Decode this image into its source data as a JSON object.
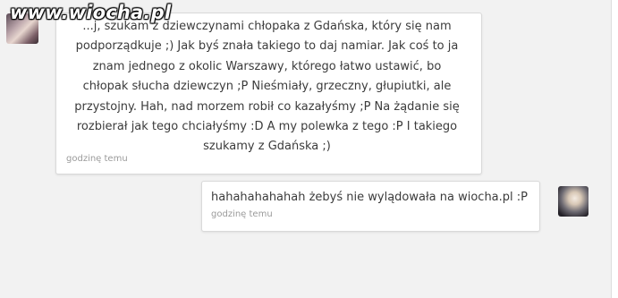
{
  "watermark": "www.wiocha.pl",
  "messages": [
    {
      "side": "left",
      "lines": [
        "...j, szukam z dziewczynami chłopaka z Gdańska, który się nam",
        "podporządkuje ;) Jak byś znała takiego to daj namiar. Jak coś to ja",
        "znam jednego z okolic Warszawy, którego łatwo ustawić, bo",
        "chłopak słucha dziewczyn ;P Nieśmiały, grzeczny, głupiutki, ale",
        "przystojny. Hah, nad morzem robił co kazałyśmy ;P Na żądanie się",
        "rozbierał jak tego chciałyśmy :D A my polewka z tego :P I takiego",
        "szukamy z Gdańska ;)"
      ],
      "time": "godzinę temu"
    },
    {
      "side": "right",
      "text": "hahahahahahah żebyś nie wylądowała na wiocha.pl :P",
      "time": "godzinę temu"
    }
  ]
}
